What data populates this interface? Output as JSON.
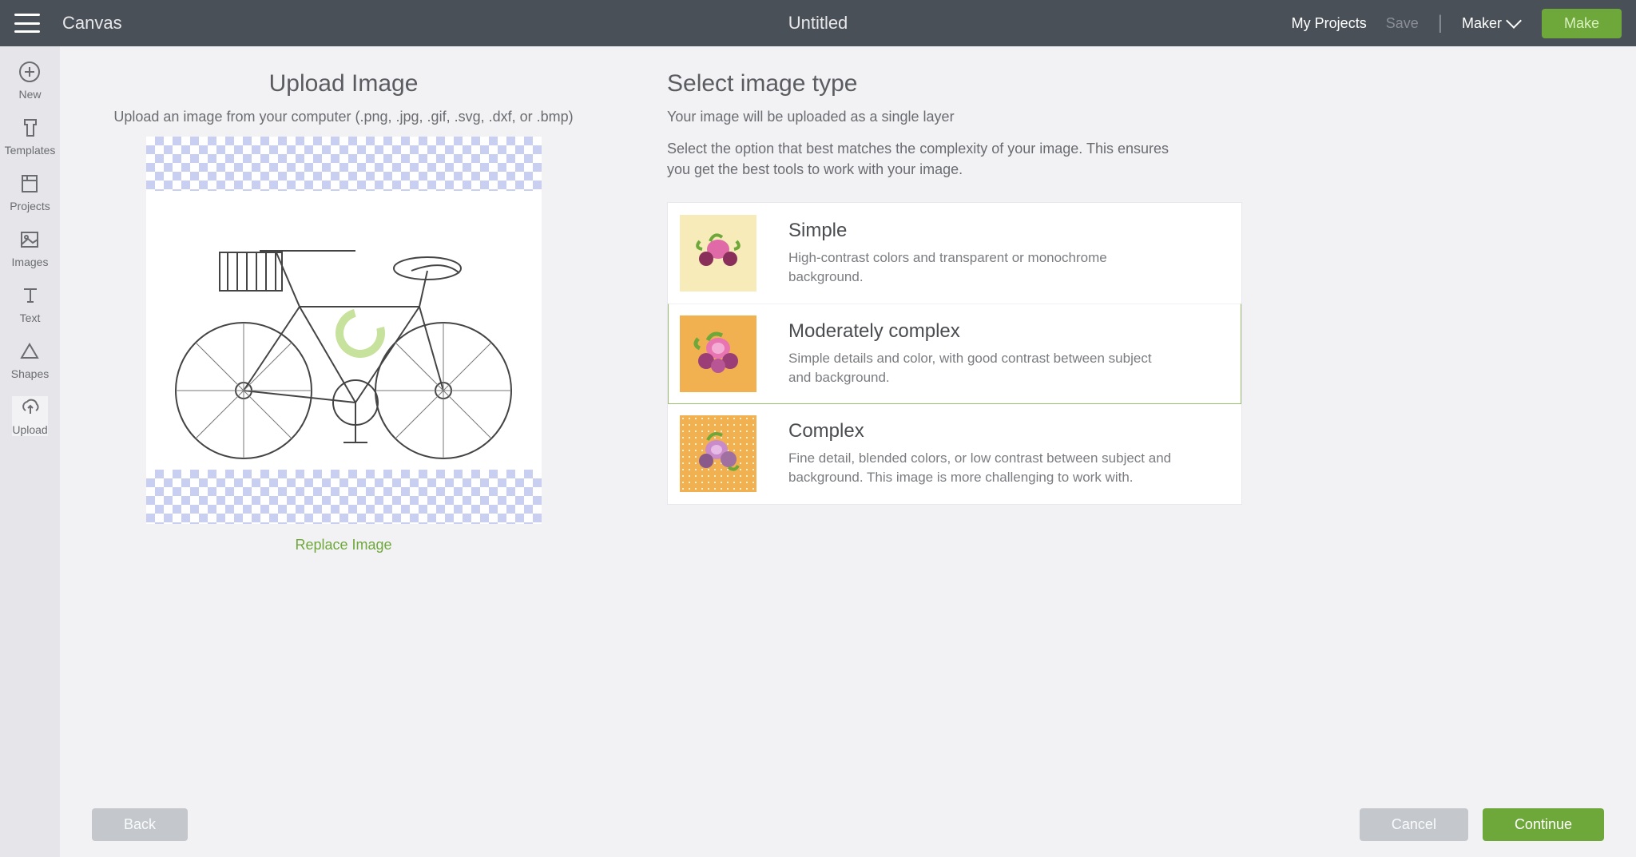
{
  "header": {
    "app_title": "Canvas",
    "doc_title": "Untitled",
    "my_projects": "My Projects",
    "save": "Save",
    "machine": "Maker",
    "make_btn": "Make"
  },
  "sidebar": {
    "items": [
      {
        "label": "New"
      },
      {
        "label": "Templates"
      },
      {
        "label": "Projects"
      },
      {
        "label": "Images"
      },
      {
        "label": "Text"
      },
      {
        "label": "Shapes"
      },
      {
        "label": "Upload"
      }
    ]
  },
  "upload": {
    "title": "Upload Image",
    "subtitle": "Upload an image from your computer (.png, .jpg, .gif, .svg, .dxf, or .bmp)",
    "replace": "Replace Image"
  },
  "select": {
    "title": "Select image type",
    "sub1": "Your image will be uploaded as a single layer",
    "sub2": "Select the option that best matches the complexity of your image. This ensures you get the best tools to work with your image.",
    "options": [
      {
        "title": "Simple",
        "desc": "High-contrast colors and transparent or monochrome background."
      },
      {
        "title": "Moderately complex",
        "desc": "Simple details and color, with good contrast between subject and background."
      },
      {
        "title": "Complex",
        "desc": "Fine detail, blended colors, or low contrast between subject and background. This image is more challenging to work with."
      }
    ]
  },
  "footer": {
    "back": "Back",
    "cancel": "Cancel",
    "continue": "Continue"
  }
}
